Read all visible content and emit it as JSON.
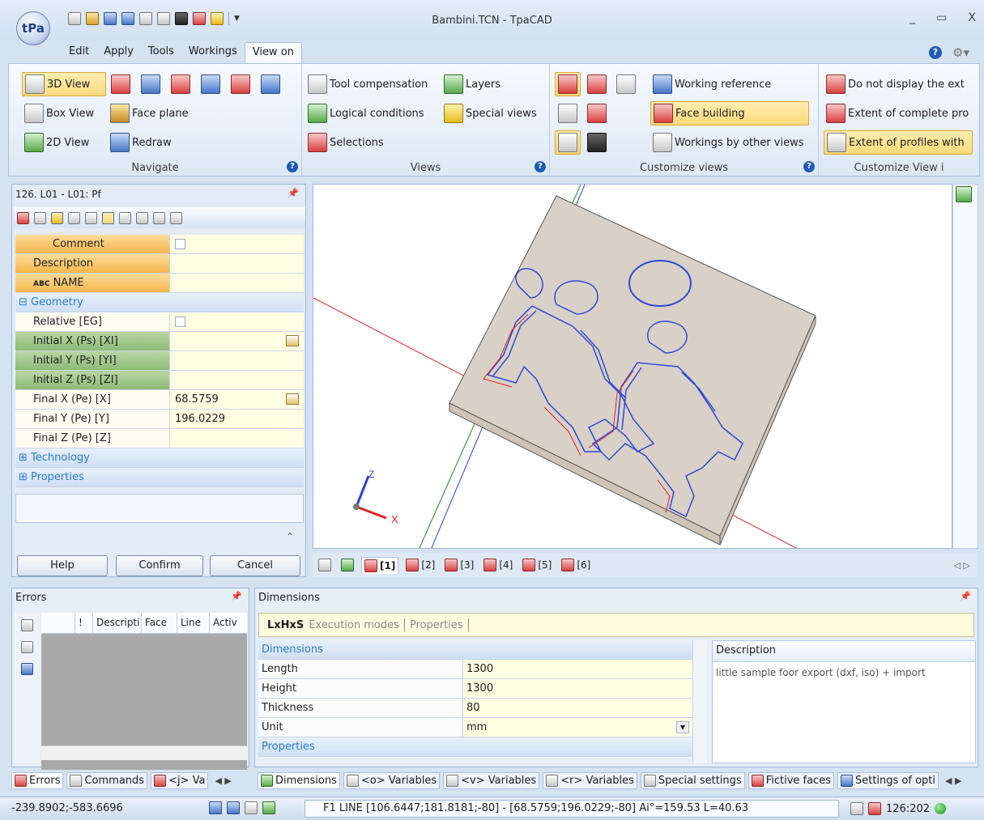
{
  "window": {
    "title": "Bambini.TCN - TpaCAD",
    "logo_text": "tPa",
    "controls": [
      "_",
      "▭",
      "X"
    ]
  },
  "ribbon_tabs": [
    {
      "label": "Edit"
    },
    {
      "label": "Apply"
    },
    {
      "label": "Tools"
    },
    {
      "label": "Workings"
    },
    {
      "label": "View on",
      "active": true
    }
  ],
  "ribbon": {
    "navigate": {
      "label": "Navigate",
      "view_3d": "3D View",
      "box_view": "Box View",
      "view_2d": "2D View",
      "face_plane": "Face plane",
      "redraw": "Redraw"
    },
    "views": {
      "label": "Views",
      "tool_compensation": "Tool compensation",
      "logical_conditions": "Logical conditions",
      "selections": "Selections",
      "layers": "Layers",
      "special_views": "Special views"
    },
    "customize_views": {
      "label": "Customize views",
      "working_reference": "Working reference",
      "face_building": "Face building",
      "workings_by_other_views": "Workings by other views"
    },
    "customize_view_i": {
      "label": "Customize View i",
      "do_not_display": "Do not display the ext",
      "extent_complete": "Extent of complete pro",
      "extent_profiles": "Extent of profiles with"
    }
  },
  "property_panel": {
    "title": "126. L01 - L01: Pf",
    "rows": [
      {
        "name": "Comment",
        "value": "",
        "kind": "checkbox",
        "style": "orange",
        "icon": true
      },
      {
        "name": "Description",
        "value": "",
        "style": "orange"
      },
      {
        "name": "NAME",
        "value": "",
        "style": "orange",
        "prefix": "ABC"
      },
      {
        "category": "Geometry"
      },
      {
        "name": "Relative [EG]",
        "value": "",
        "kind": "checkbox",
        "style": "white"
      },
      {
        "name": "Initial X (Ps) [XI]",
        "value": "",
        "style": "green",
        "edit": true
      },
      {
        "name": "Initial Y (Ps) [YI]",
        "value": "",
        "style": "green"
      },
      {
        "name": "Initial Z (Ps) [ZI]",
        "value": "",
        "style": "green"
      },
      {
        "name": "Final X (Pe) [X]",
        "value": "68.5759",
        "style": "white",
        "edit": true
      },
      {
        "name": "Final Y (Pe) [Y]",
        "value": "196.0229",
        "style": "white"
      },
      {
        "name": "Final Z (Pe) [Z]",
        "value": "",
        "style": "white"
      },
      {
        "category": "Technology"
      },
      {
        "category": "Properties"
      }
    ],
    "buttons": {
      "help": "Help",
      "confirm": "Confirm",
      "cancel": "Cancel"
    }
  },
  "views_tabs": [
    "[1]",
    "[2]",
    "[3]",
    "[4]",
    "[5]",
    "[6]"
  ],
  "errors_panel": {
    "title": "Errors",
    "columns": [
      "!",
      "Descripti",
      "Face",
      "Line",
      "Activ"
    ]
  },
  "dimensions_panel": {
    "title": "Dimensions",
    "tabs": [
      {
        "label": "LxHxS",
        "active": true
      },
      {
        "label": "Execution modes"
      },
      {
        "label": "Properties"
      }
    ],
    "section": "Dimensions",
    "rows": [
      {
        "name": "Length",
        "value": "1300"
      },
      {
        "name": "Height",
        "value": "1300"
      },
      {
        "name": "Thickness",
        "value": "80"
      },
      {
        "name": "Unit",
        "value": "mm",
        "dropdown": true
      }
    ],
    "section2": "Properties",
    "description_header": "Description",
    "description_text": "little sample foor export (dxf, iso) + import"
  },
  "bottom_tabs_left": [
    "Errors",
    "Commands",
    "<j> Va"
  ],
  "bottom_tabs_right": [
    "Dimensions",
    "<o> Variables",
    "<v> Variables",
    "<r> Variables",
    "Special settings",
    "Fictive faces",
    "Settings of opti"
  ],
  "status": {
    "coords": "-239.8902;-583.6696",
    "line": "F1 LINE [106.6447;181.8181;-80] - [68.5759;196.0229;-80] Ai°=159.53 L=40.63",
    "counter": "126:202"
  },
  "viewport": {
    "panel_color": "#d9d1c8",
    "edge_color": "#cfc4b6",
    "profile_blue": "#2e48d8",
    "profile_red": "#e02020",
    "axis_red": "#e02424",
    "axis_green": "#1a8a1a",
    "axis_blue": "#2a3fd0",
    "axis_x_label": "X",
    "axis_z_label": "Z"
  }
}
